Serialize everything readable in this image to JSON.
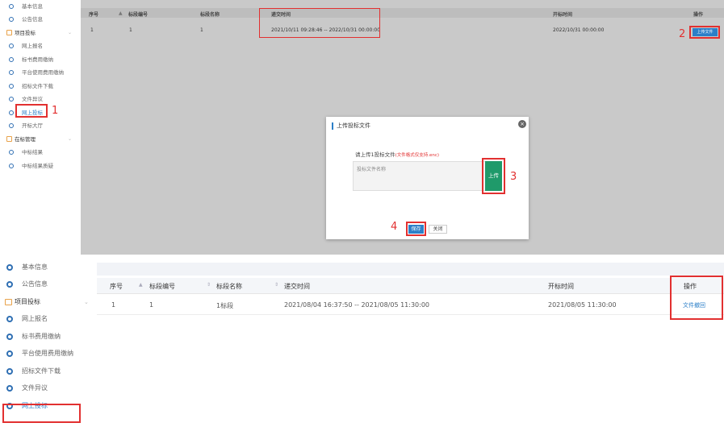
{
  "top": {
    "sidebar": [
      {
        "label": "基本信息",
        "type": "item"
      },
      {
        "label": "公告信息",
        "type": "item"
      },
      {
        "label": "项目投标",
        "type": "group"
      },
      {
        "label": "网上报名",
        "type": "item"
      },
      {
        "label": "标书费用缴纳",
        "type": "item"
      },
      {
        "label": "平台使用费用缴纳",
        "type": "item"
      },
      {
        "label": "招标文件下载",
        "type": "item"
      },
      {
        "label": "文件异议",
        "type": "item"
      },
      {
        "label": "网上投标",
        "type": "item",
        "highlight": true
      },
      {
        "label": "开标大厅",
        "type": "item"
      },
      {
        "label": "在标管理",
        "type": "group"
      },
      {
        "label": "中标结果",
        "type": "item"
      },
      {
        "label": "中标结果质疑",
        "type": "item"
      }
    ],
    "table": {
      "headers": [
        "序号",
        "标段编号",
        "标段名称",
        "递交时间",
        "开标时间",
        "操作"
      ],
      "row": [
        "1",
        "1",
        "1",
        "2021/10/11 09:28:46 -- 2022/10/31 00:00:00",
        "2022/10/31 00:00:00"
      ],
      "action": "上传文件"
    },
    "dialog": {
      "title": "上传投标文件",
      "close": "×",
      "prompt": "请上传1投标文件",
      "hint": "(文件格式仅支持.enc)",
      "placeholder": "投标文件名称",
      "upload": "上传",
      "save": "保存",
      "cancel": "关闭"
    },
    "steps": [
      "1",
      "2",
      "3",
      "4"
    ]
  },
  "bottom": {
    "sidebar": [
      {
        "label": "基本信息",
        "type": "item"
      },
      {
        "label": "公告信息",
        "type": "item"
      },
      {
        "label": "项目投标",
        "type": "group"
      },
      {
        "label": "网上报名",
        "type": "item"
      },
      {
        "label": "标书费用缴纳",
        "type": "item"
      },
      {
        "label": "平台使用费用缴纳",
        "type": "item"
      },
      {
        "label": "招标文件下载",
        "type": "item"
      },
      {
        "label": "文件异议",
        "type": "item"
      },
      {
        "label": "网上投标",
        "type": "item",
        "highlight": true
      }
    ],
    "table": {
      "headers": [
        "序号",
        "标段编号",
        "标段名称",
        "递交时间",
        "开标时间",
        "操作"
      ],
      "row": [
        "1",
        "1",
        "1标段",
        "2021/08/04 16:37:50 -- 2021/08/05 11:30:00",
        "2021/08/05 11:30:00"
      ],
      "action": "文件撤回"
    }
  },
  "colors": {
    "accent": "#2c7fc8",
    "highlight": "#e23030",
    "upload_green": "#1f9a6a",
    "folder": "#e8a24a"
  }
}
